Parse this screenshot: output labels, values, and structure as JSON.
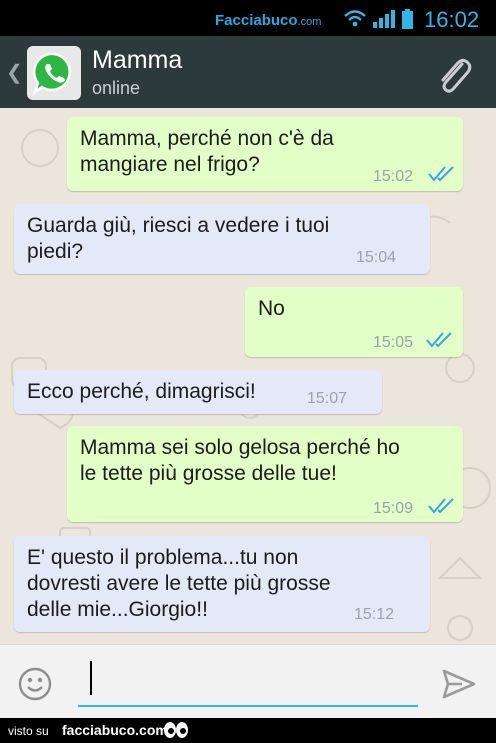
{
  "status_bar": {
    "watermark": "Facciabuco",
    "watermark_suffix": ".com",
    "time": "16:02",
    "accent_color": "#33b5e5"
  },
  "header": {
    "contact_name": "Mamma",
    "contact_status": "online",
    "avatar_icon": "whatsapp-logo-icon",
    "attach_icon": "paperclip-icon"
  },
  "messages": [
    {
      "direction": "outgoing",
      "text": "Mamma, perché non c'è da\nmangiare nel frigo?",
      "time": "15:02",
      "read": true
    },
    {
      "direction": "incoming",
      "text": "Guarda giù, riesci a vedere i tuoi\npiedi?",
      "time": "15:04"
    },
    {
      "direction": "outgoing",
      "text": "No",
      "time": "15:05",
      "read": true
    },
    {
      "direction": "incoming",
      "text": "Ecco perché, dimagrisci!",
      "time": "15:07"
    },
    {
      "direction": "outgoing",
      "text": "Mamma sei solo gelosa perché ho\nle tette più grosse delle tue!",
      "time": "15:09",
      "read": true
    },
    {
      "direction": "incoming",
      "text": "E' questo il problema...tu non\ndovresti avere le tette più grosse\ndelle mie...Giorgio!!",
      "time": "15:12"
    }
  ],
  "input_bar": {
    "value": "",
    "emoji_icon": "smiley-icon",
    "send_icon": "send-icon"
  },
  "footer": {
    "visto_su": "visto su",
    "site": "facciabuco.com"
  },
  "colors": {
    "outgoing_bubble": "#e2ffc7",
    "incoming_bubble": "#e3e9f7",
    "header_bg": "#2c3a3b",
    "chat_bg": "#ece5dc",
    "read_tick": "#3aa3e0"
  }
}
